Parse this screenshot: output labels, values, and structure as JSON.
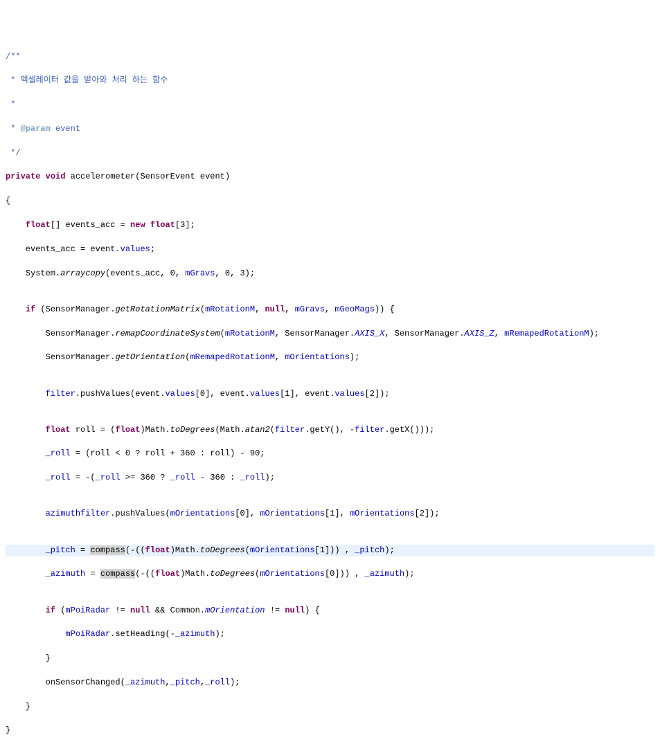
{
  "code": {
    "c0": "/**",
    "c1": " * 엑셀레이터 값을 받아와 처리 하는 함수",
    "c2": " *",
    "c3_a": " * ",
    "c3_b": "@param",
    "c3_c": " event",
    "c4": " */",
    "l5_a": "private",
    "l5_b": " ",
    "l5_c": "void",
    "l5_d": " accelerometer(SensorEvent event)",
    "l6": "{",
    "l7_a": "    ",
    "l7_b": "float",
    "l7_c": "[] events_acc = ",
    "l7_d": "new",
    "l7_e": " ",
    "l7_f": "float",
    "l7_g": "[3];",
    "l8_a": "    events_acc = event.",
    "l8_b": "values",
    "l8_c": ";",
    "l9_a": "    System.",
    "l9_b": "arraycopy",
    "l9_c": "(events_acc, 0, ",
    "l9_d": "mGravs",
    "l9_e": ", 0, 3);",
    "blank1": "",
    "l10_a": "    ",
    "l10_b": "if",
    "l10_c": " (SensorManager.",
    "l10_d": "getRotationMatrix",
    "l10_e": "(",
    "l10_f": "mRotationM",
    "l10_g": ", ",
    "l10_h": "null",
    "l10_i": ", ",
    "l10_j": "mGravs",
    "l10_k": ", ",
    "l10_l": "mGeoMags",
    "l10_m": ")) {",
    "l11_a": "        SensorManager.",
    "l11_b": "remapCoordinateSystem",
    "l11_c": "(",
    "l11_d": "mRotationM",
    "l11_e": ", SensorManager.",
    "l11_f": "AXIS_X",
    "l11_g": ", SensorManager.",
    "l11_h": "AXIS_Z",
    "l11_i": ", ",
    "l11_j": "mRemapedRotationM",
    "l11_k": ");",
    "l12_a": "        SensorManager.",
    "l12_b": "getOrientation",
    "l12_c": "(",
    "l12_d": "mRemapedRotationM",
    "l12_e": ", ",
    "l12_f": "mOrientations",
    "l12_g": ");",
    "blank2": "",
    "l13_a": "        ",
    "l13_b": "filter",
    "l13_c": ".pushValues(event.",
    "l13_d": "values",
    "l13_e": "[0], event.",
    "l13_f": "values",
    "l13_g": "[1], event.",
    "l13_h": "values",
    "l13_i": "[2]);",
    "blank3": "",
    "l14_a": "        ",
    "l14_b": "float",
    "l14_c": " roll = (",
    "l14_d": "float",
    "l14_e": ")Math.",
    "l14_f": "toDegrees",
    "l14_g": "(Math.",
    "l14_h": "atan2",
    "l14_i": "(",
    "l14_j": "filter",
    "l14_k": ".getY(), -",
    "l14_l": "filter",
    "l14_m": ".getX()));",
    "l15_a": "        ",
    "l15_b": "_roll",
    "l15_c": " = (roll < 0 ? roll + 360 : roll) - 90;",
    "l16_a": "        ",
    "l16_b": "_roll",
    "l16_c": " = -(",
    "l16_d": "_roll",
    "l16_e": " >= 360 ? ",
    "l16_f": "_roll",
    "l16_g": " - 360 : ",
    "l16_h": "_roll",
    "l16_i": ");",
    "blank4": "",
    "l17_a": "        ",
    "l17_b": "azimuthfilter",
    "l17_c": ".pushValues(",
    "l17_d": "mOrientations",
    "l17_e": "[0], ",
    "l17_f": "mOrientations",
    "l17_g": "[1], ",
    "l17_h": "mOrientations",
    "l17_i": "[2]);",
    "blank5": "",
    "l18_a": "        ",
    "l18_b": "_pitch",
    "l18_c": " = ",
    "l18_sel": "compass",
    "l18_d": "(-((",
    "l18_e": "float",
    "l18_f": ")Math.",
    "l18_g": "toDegrees",
    "l18_h": "(",
    "l18_i": "mOrientations",
    "l18_j": "[1])) , ",
    "l18_k": "_pitch",
    "l18_l": ");",
    "l19_a": "        ",
    "l19_b": "_azimuth",
    "l19_c": " = ",
    "l19_sel": "compass",
    "l19_d": "(-((",
    "l19_e": "float",
    "l19_f": ")Math.",
    "l19_g": "toDegrees",
    "l19_h": "(",
    "l19_i": "mOrientations",
    "l19_j": "[0])) , ",
    "l19_k": "_azimuth",
    "l19_l": ");",
    "blank6": "",
    "l20_a": "        ",
    "l20_b": "if",
    "l20_c": " (",
    "l20_d": "mPoiRadar",
    "l20_e": " != ",
    "l20_f": "null",
    "l20_g": " && Common.",
    "l20_h": "mOrientation",
    "l20_i": " != ",
    "l20_j": "null",
    "l20_k": ") {",
    "l21_a": "            ",
    "l21_b": "mPoiRadar",
    "l21_c": ".setHeading(-",
    "l21_d": "_azimuth",
    "l21_e": ");",
    "l22": "        }",
    "l23_a": "        onSensorChanged(",
    "l23_b": "_azimuth",
    "l23_c": ",",
    "l23_d": "_pitch",
    "l23_e": ",",
    "l23_f": "_roll",
    "l23_g": ");",
    "l24": "    }",
    "l25": "}"
  }
}
